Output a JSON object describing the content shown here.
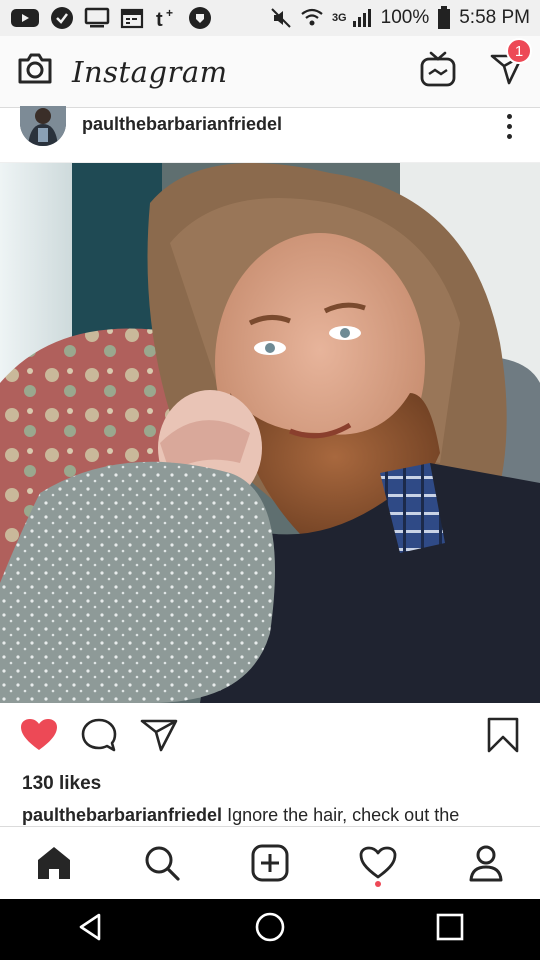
{
  "status_bar": {
    "battery": "100%",
    "time": "5:58 PM",
    "network": "3G",
    "left_icons": [
      "youtube-icon",
      "vpn-check-icon",
      "screen-icon",
      "calendar-icon",
      "tumblr-icon",
      "shield-icon"
    ],
    "right_icons": [
      "mute-icon",
      "wifi-icon",
      "signal-icon",
      "battery-icon"
    ]
  },
  "app_bar": {
    "brand": "Instagram",
    "dm_badge": "1"
  },
  "post": {
    "username": "paulthebarbarianfriedel",
    "likes": "130 likes",
    "caption_user": "paulthebarbarianfriedel",
    "caption_text": "Ignore the hair, check out the",
    "liked": true
  },
  "bottom_nav": [
    "home",
    "search",
    "new-post",
    "activity",
    "profile"
  ],
  "colors": {
    "heart": "#ed4956",
    "badge": "#ed4956",
    "text": "#262626"
  }
}
